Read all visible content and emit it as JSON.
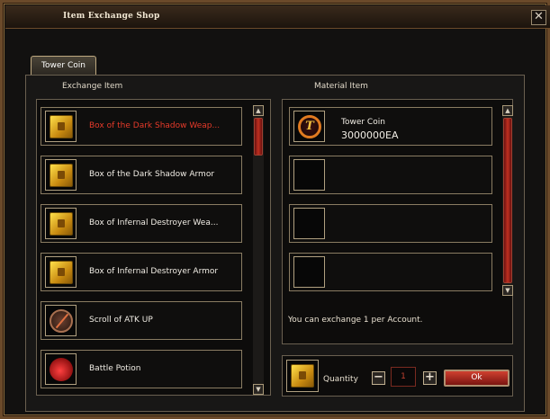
{
  "window": {
    "title": "Item Exchange Shop"
  },
  "tabs": [
    {
      "label": "Tower Coin"
    }
  ],
  "exchange": {
    "header": "Exchange Item",
    "items": [
      {
        "label": "Box of the Dark Shadow Weap...",
        "icon": "chest-icon",
        "selected": true
      },
      {
        "label": "Box of the Dark Shadow Armor",
        "icon": "chest-icon"
      },
      {
        "label": "Box of Infernal Destroyer Wea...",
        "icon": "chest-icon"
      },
      {
        "label": "Box of Infernal Destroyer Armor",
        "icon": "chest-icon"
      },
      {
        "label": "Scroll of ATK UP",
        "icon": "scroll-icon"
      },
      {
        "label": "Battle Potion",
        "icon": "potion-icon"
      }
    ]
  },
  "material": {
    "header": "Material Item",
    "items": [
      {
        "name": "Tower Coin",
        "quantity": "3000000EA",
        "icon": "tower-coin-icon",
        "coin_glyph": "T"
      }
    ],
    "empty_slots": 3
  },
  "notice": "You can exchange 1 per Account.",
  "purchase": {
    "quantity_label": "Quantity",
    "minus": "−",
    "plus": "+",
    "quantity_value": "1",
    "ok_label": "Ok"
  },
  "colors": {
    "selected_text": "#e63a2a",
    "accent_red": "#c03020",
    "frame": "#6b4a2a"
  }
}
